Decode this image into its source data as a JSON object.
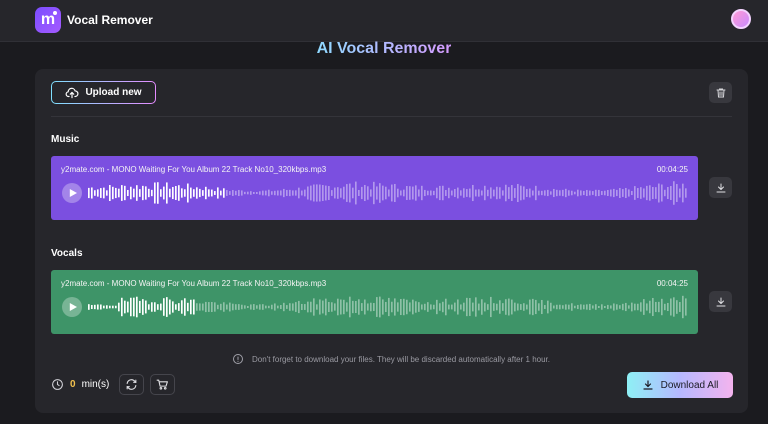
{
  "app": {
    "name": "Vocal Remover"
  },
  "page": {
    "title": "AI Vocal Remover"
  },
  "toolbar": {
    "upload_label": "Upload new"
  },
  "tracks": [
    {
      "section": "Music",
      "file": "y2mate.com - MONO Waiting For You Album 22 Track No10_320kbps.mp3",
      "duration": "00:04:25",
      "color": "#7b4fe0"
    },
    {
      "section": "Vocals",
      "file": "y2mate.com - MONO Waiting For You Album 22 Track No10_320kbps.mp3",
      "duration": "00:04:25",
      "color": "#3e9468"
    }
  ],
  "notice": "Don't forget to download your files. They will be discarded automatically after 1 hour.",
  "footer": {
    "minutes_value": "0",
    "minutes_unit": "min(s)",
    "download_all": "Download All"
  },
  "icons": [
    "upload-icon",
    "trash-icon",
    "play-icon",
    "download-icon",
    "info-icon",
    "clock-icon",
    "refresh-icon",
    "cart-icon"
  ]
}
